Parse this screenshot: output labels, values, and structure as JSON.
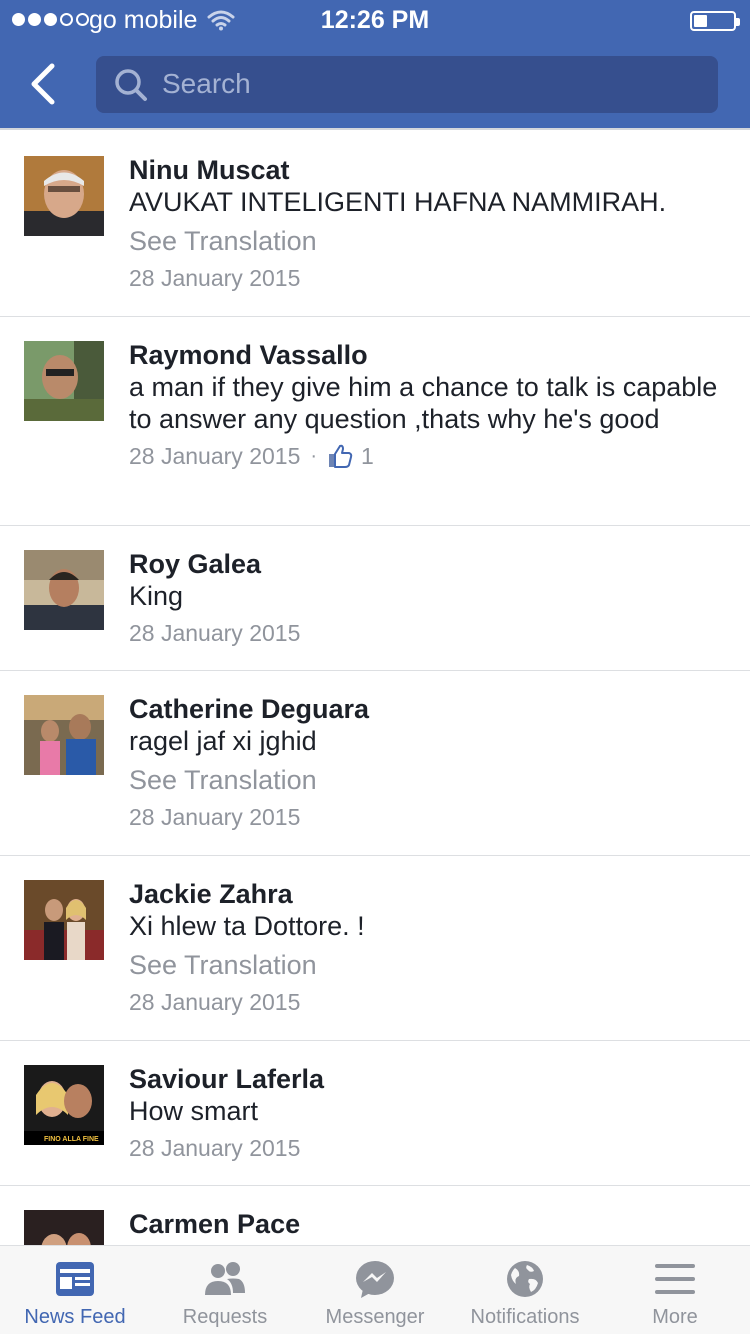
{
  "status_bar": {
    "carrier": "go mobile",
    "time": "12:26 PM"
  },
  "header": {
    "search_placeholder": "Search"
  },
  "comments": [
    {
      "author": "Ninu Muscat",
      "text": "AVUKAT INTELIGENTI HAFNA NAMMIRAH.",
      "translate_label": "See Translation",
      "date": "28 January 2015"
    },
    {
      "author": "Raymond Vassallo",
      "text": "a man if they give him a chance to talk is capable to answer any question ,thats why he's good",
      "date": "28 January 2015",
      "separator": "·",
      "likes": "1"
    },
    {
      "author": "Roy Galea",
      "text": "King",
      "date": "28 January 2015"
    },
    {
      "author": "Catherine Deguara",
      "text": "ragel jaf xi jghid",
      "translate_label": "See Translation",
      "date": "28 January 2015"
    },
    {
      "author": "Jackie Zahra",
      "text": "Xi hlew ta Dottore. !",
      "translate_label": "See Translation",
      "date": "28 January 2015"
    },
    {
      "author": "Saviour Laferla",
      "text": "How smart",
      "date": "28 January 2015",
      "avatar_caption": "FINO ALLA FINE"
    },
    {
      "author": "Carmen Pace"
    }
  ],
  "tab_bar": {
    "active_tab": "News Feed",
    "tabs": [
      {
        "label": "News Feed",
        "icon": "news-feed-icon"
      },
      {
        "label": "Requests",
        "icon": "friends-icon"
      },
      {
        "label": "Messenger",
        "icon": "messenger-icon"
      },
      {
        "label": "Notifications",
        "icon": "globe-icon"
      },
      {
        "label": "More",
        "icon": "menu-icon"
      }
    ]
  },
  "colors": {
    "header_blue": "#4267b2",
    "search_field": "#364f8e",
    "secondary_text": "#90949c",
    "primary_text": "#1d2129"
  }
}
